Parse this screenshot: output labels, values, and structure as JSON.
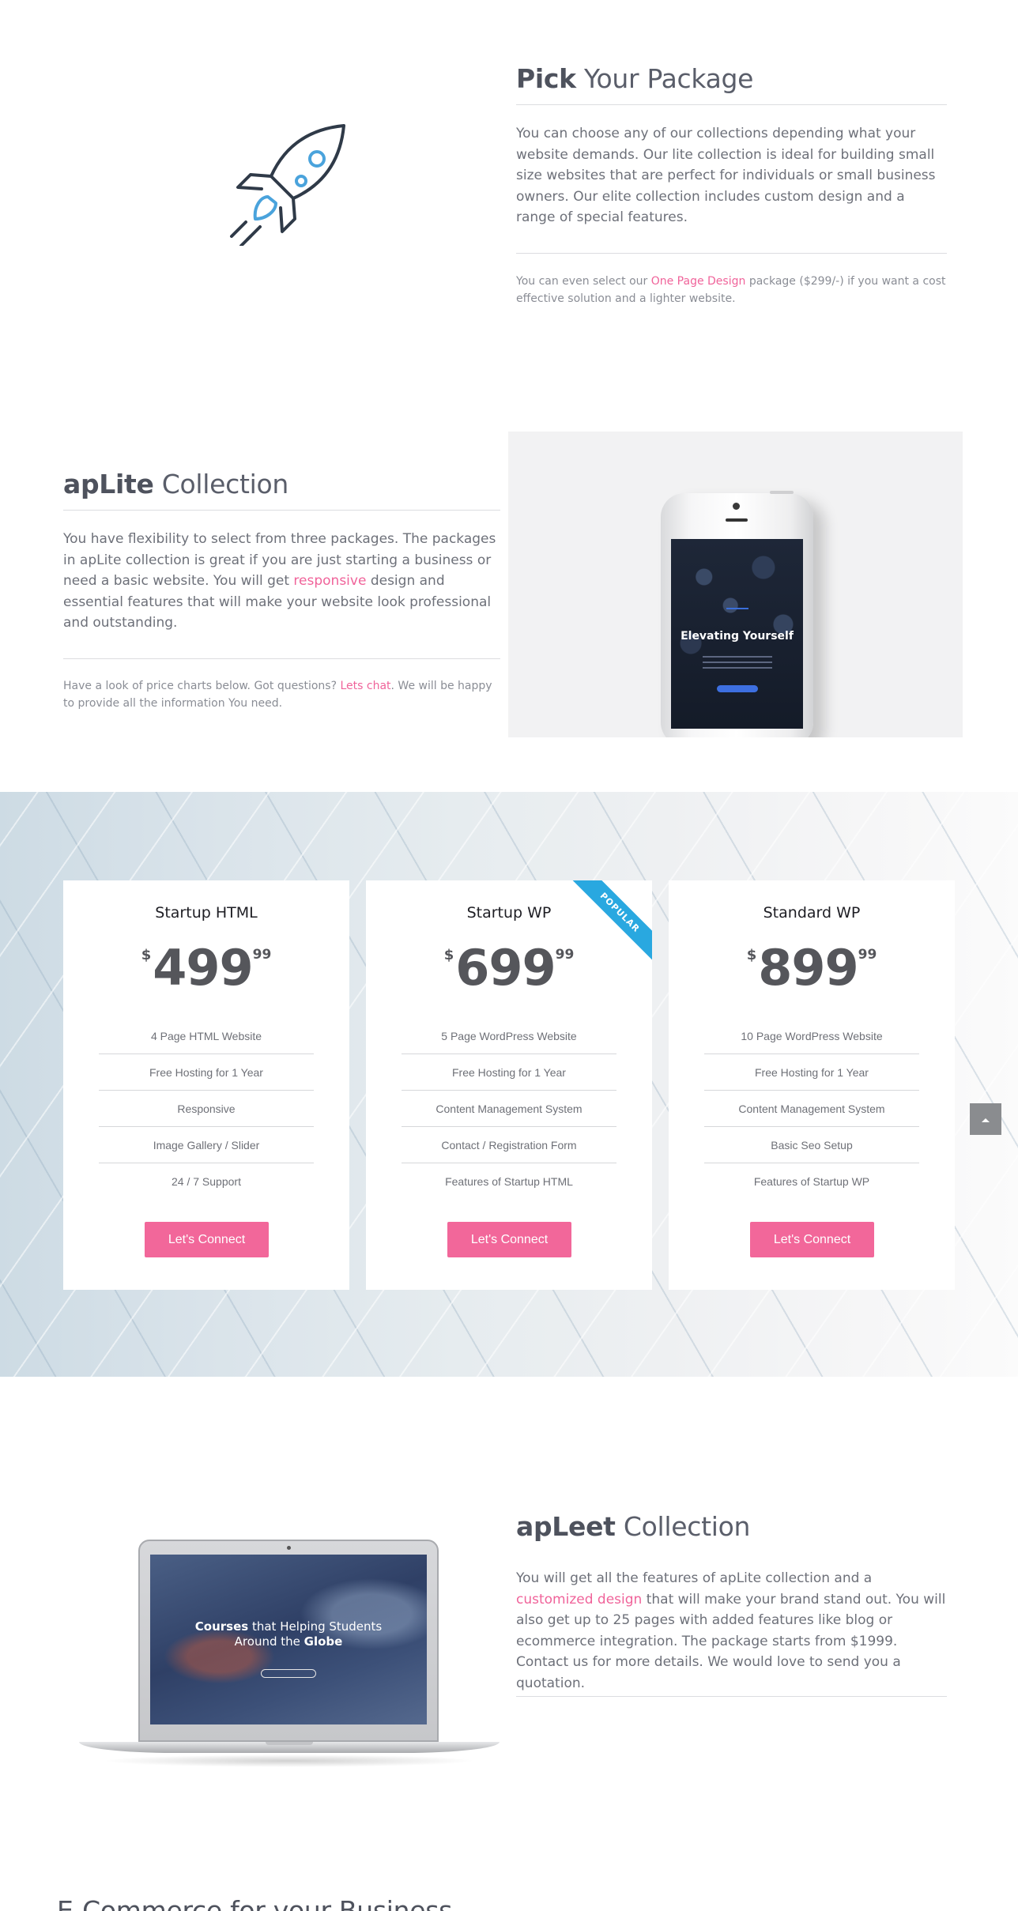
{
  "pick_section": {
    "title_bold": "Pick",
    "title_rest": "Your Package",
    "paragraph": "You can choose any of our collections depending what your website demands. Our lite collection is ideal for building small size websites that are perfect for individuals or small business owners. Our elite collection includes custom design and a range of special features.",
    "note_before": "You can even select our",
    "note_link": "One Page Design",
    "note_after": "package ($299/-) if you want a cost effective solution and a lighter website.",
    "icon": "rocket-icon"
  },
  "aplite_section": {
    "title_bold": "apLite",
    "title_rest": "Collection",
    "para_before": "You have flexibility to select from three packages. The packages in apLite collection is great if you are just starting a business or need a basic website. You will get",
    "para_link": "responsive",
    "para_after": "design and essential features that will make your website look professional and outstanding.",
    "note_before": "Have a look of price charts below. Got questions?",
    "note_link": "Lets chat",
    "note_after": ". We will be happy to provide all the information You need.",
    "phone_headline": "Elevating Yourself"
  },
  "pricing": {
    "currency": "$",
    "button_label": "Let's Connect",
    "popular_label": "POPULAR",
    "plans": [
      {
        "name": "Startup HTML",
        "price": "499",
        "cents": "99",
        "features": [
          "4 Page HTML Website",
          "Free Hosting for 1 Year",
          "Responsive",
          "Image Gallery / Slider",
          "24 / 7 Support"
        ]
      },
      {
        "name": "Startup WP",
        "price": "699",
        "cents": "99",
        "features": [
          "5 Page WordPress Website",
          "Free Hosting for 1 Year",
          "Content Management System",
          "Contact / Registration Form",
          "Features of Startup HTML"
        ]
      },
      {
        "name": "Standard WP",
        "price": "899",
        "cents": "99",
        "features": [
          "10 Page WordPress Website",
          "Free Hosting for 1 Year",
          "Content Management System",
          "Basic Seo Setup",
          "Features of Startup WP"
        ]
      }
    ],
    "scroll_top_icon": "chevron-up-icon"
  },
  "apleet_section": {
    "title_bold": "apLeet",
    "title_rest": "Collection",
    "para_before": "You will get all the features of apLite collection and a",
    "para_link": "customized design",
    "para_after": "that will make your brand stand out. You will also get up to 25 pages with added features like blog or ecommerce integration. The package starts from $1999. Contact us for more details. We would love to send you a quotation.",
    "laptop_headline_1a": "Courses",
    "laptop_headline_1b": "that Helping Students",
    "laptop_headline_2a": "Around the",
    "laptop_headline_2b": "Globe"
  },
  "next_section": {
    "title": "E-Commerce for your Business"
  },
  "colors": {
    "accent_pink": "#f2679a",
    "ribbon_blue": "#29a8e0",
    "heading": "#5a5e6a"
  }
}
